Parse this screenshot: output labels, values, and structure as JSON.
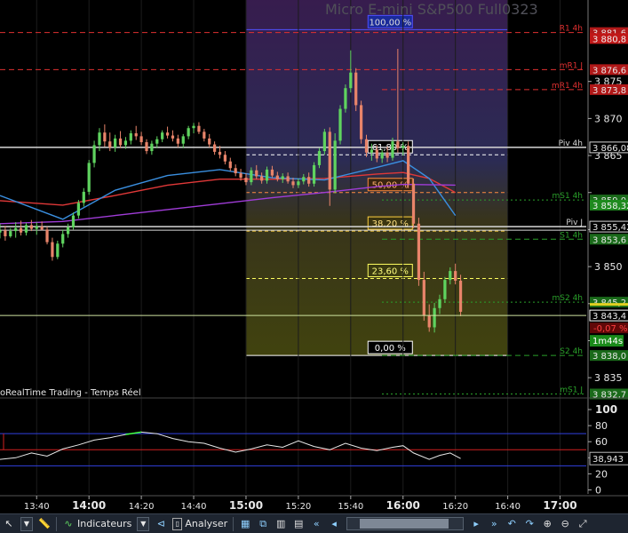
{
  "window_title": "Micro E-mini S&P500 Full0323",
  "subchart_title": "oRealTime Trading - Temps Réel",
  "colors": {
    "background": "#000000",
    "up": "#5fd35f",
    "down": "#e8846a",
    "resistance": "#e03030",
    "support": "#2aa02a",
    "pivot": "#d8d8d8"
  },
  "chart_data": {
    "type": "candlestick",
    "price_axis": {
      "range": [
        3832.5,
        3886.0
      ],
      "ticks": [
        3875,
        3870,
        3865,
        3860,
        3855,
        3850,
        3845,
        3840,
        3835
      ],
      "tick_labels": [
        "3 875",
        "3 870",
        "3 865",
        "",
        "",
        "3 850",
        "",
        "",
        "3 835"
      ]
    },
    "time_axis": {
      "start": "13:26",
      "end": "17:10",
      "ticks": [
        "13:40",
        "14:00",
        "14:20",
        "14:40",
        "15:00",
        "15:20",
        "15:40",
        "16:00",
        "16:20",
        "16:40",
        "17:00"
      ],
      "bold_ticks": [
        "14:00",
        "15:00",
        "16:00",
        "17:00"
      ]
    },
    "candles": [
      {
        "t": "13:26",
        "o": 3854.6,
        "h": 3855.8,
        "l": 3853.8,
        "c": 3854.9
      },
      {
        "t": "13:28",
        "o": 3854.9,
        "h": 3855.5,
        "l": 3853.5,
        "c": 3854.1
      },
      {
        "t": "13:30",
        "o": 3854.1,
        "h": 3855.2,
        "l": 3853.9,
        "c": 3854.8
      },
      {
        "t": "13:32",
        "o": 3854.8,
        "h": 3856.0,
        "l": 3853.9,
        "c": 3855.2
      },
      {
        "t": "13:34",
        "o": 3855.2,
        "h": 3856.2,
        "l": 3854.2,
        "c": 3854.6
      },
      {
        "t": "13:36",
        "o": 3854.6,
        "h": 3855.9,
        "l": 3854.2,
        "c": 3855.6
      },
      {
        "t": "13:38",
        "o": 3855.6,
        "h": 3856.3,
        "l": 3854.8,
        "c": 3855.1
      },
      {
        "t": "13:40",
        "o": 3855.1,
        "h": 3856.0,
        "l": 3854.3,
        "c": 3855.4
      },
      {
        "t": "13:42",
        "o": 3855.4,
        "h": 3856.1,
        "l": 3854.9,
        "c": 3855.0
      },
      {
        "t": "13:44",
        "o": 3855.0,
        "h": 3855.4,
        "l": 3853.0,
        "c": 3853.3
      },
      {
        "t": "13:46",
        "o": 3853.3,
        "h": 3853.9,
        "l": 3850.8,
        "c": 3851.3
      },
      {
        "t": "13:48",
        "o": 3851.3,
        "h": 3853.5,
        "l": 3851.0,
        "c": 3853.1
      },
      {
        "t": "13:50",
        "o": 3853.1,
        "h": 3855.0,
        "l": 3852.6,
        "c": 3854.4
      },
      {
        "t": "13:52",
        "o": 3854.4,
        "h": 3855.8,
        "l": 3853.9,
        "c": 3855.3
      },
      {
        "t": "13:54",
        "o": 3855.3,
        "h": 3857.3,
        "l": 3855.0,
        "c": 3856.9
      },
      {
        "t": "13:56",
        "o": 3856.9,
        "h": 3859.0,
        "l": 3856.5,
        "c": 3858.6
      },
      {
        "t": "13:58",
        "o": 3858.6,
        "h": 3860.6,
        "l": 3858.1,
        "c": 3860.1
      },
      {
        "t": "14:00",
        "o": 3860.1,
        "h": 3864.4,
        "l": 3859.7,
        "c": 3864.0
      },
      {
        "t": "14:02",
        "o": 3864.0,
        "h": 3867.0,
        "l": 3863.4,
        "c": 3866.4
      },
      {
        "t": "14:04",
        "o": 3866.4,
        "h": 3868.7,
        "l": 3865.6,
        "c": 3868.1
      },
      {
        "t": "14:06",
        "o": 3868.1,
        "h": 3869.2,
        "l": 3866.2,
        "c": 3866.9
      },
      {
        "t": "14:08",
        "o": 3866.9,
        "h": 3868.1,
        "l": 3865.6,
        "c": 3866.1
      },
      {
        "t": "14:10",
        "o": 3866.1,
        "h": 3867.8,
        "l": 3865.5,
        "c": 3867.3
      },
      {
        "t": "14:12",
        "o": 3867.3,
        "h": 3868.3,
        "l": 3866.0,
        "c": 3866.4
      },
      {
        "t": "14:14",
        "o": 3866.4,
        "h": 3867.5,
        "l": 3865.9,
        "c": 3867.0
      },
      {
        "t": "14:16",
        "o": 3867.0,
        "h": 3868.4,
        "l": 3866.5,
        "c": 3868.0
      },
      {
        "t": "14:18",
        "o": 3868.0,
        "h": 3869.0,
        "l": 3867.1,
        "c": 3867.6
      },
      {
        "t": "14:20",
        "o": 3867.6,
        "h": 3868.2,
        "l": 3866.4,
        "c": 3866.8
      },
      {
        "t": "14:22",
        "o": 3866.8,
        "h": 3867.2,
        "l": 3865.2,
        "c": 3865.6
      },
      {
        "t": "14:24",
        "o": 3865.6,
        "h": 3867.0,
        "l": 3865.1,
        "c": 3866.6
      },
      {
        "t": "14:26",
        "o": 3866.6,
        "h": 3867.6,
        "l": 3866.0,
        "c": 3867.2
      },
      {
        "t": "14:28",
        "o": 3867.2,
        "h": 3868.4,
        "l": 3866.8,
        "c": 3868.1
      },
      {
        "t": "14:30",
        "o": 3868.1,
        "h": 3868.9,
        "l": 3867.3,
        "c": 3867.7
      },
      {
        "t": "14:32",
        "o": 3867.7,
        "h": 3868.4,
        "l": 3866.9,
        "c": 3867.3
      },
      {
        "t": "14:34",
        "o": 3867.3,
        "h": 3867.8,
        "l": 3866.1,
        "c": 3866.6
      },
      {
        "t": "14:36",
        "o": 3866.6,
        "h": 3867.9,
        "l": 3866.0,
        "c": 3867.6
      },
      {
        "t": "14:38",
        "o": 3867.6,
        "h": 3869.0,
        "l": 3867.2,
        "c": 3868.7
      },
      {
        "t": "14:40",
        "o": 3868.7,
        "h": 3869.4,
        "l": 3868.0,
        "c": 3869.0
      },
      {
        "t": "14:42",
        "o": 3869.0,
        "h": 3869.5,
        "l": 3867.9,
        "c": 3868.2
      },
      {
        "t": "14:44",
        "o": 3868.2,
        "h": 3868.6,
        "l": 3866.9,
        "c": 3867.3
      },
      {
        "t": "14:46",
        "o": 3867.3,
        "h": 3867.9,
        "l": 3866.1,
        "c": 3866.5
      },
      {
        "t": "14:48",
        "o": 3866.5,
        "h": 3866.9,
        "l": 3865.1,
        "c": 3865.5
      },
      {
        "t": "14:50",
        "o": 3865.5,
        "h": 3866.3,
        "l": 3864.6,
        "c": 3865.1
      },
      {
        "t": "14:52",
        "o": 3865.1,
        "h": 3865.6,
        "l": 3863.8,
        "c": 3864.2
      },
      {
        "t": "14:54",
        "o": 3864.2,
        "h": 3864.7,
        "l": 3862.9,
        "c": 3863.3
      },
      {
        "t": "14:56",
        "o": 3863.3,
        "h": 3863.8,
        "l": 3862.2,
        "c": 3862.6
      },
      {
        "t": "14:58",
        "o": 3862.6,
        "h": 3863.2,
        "l": 3861.6,
        "c": 3862.0
      },
      {
        "t": "15:00",
        "o": 3862.0,
        "h": 3862.6,
        "l": 3861.0,
        "c": 3861.4
      },
      {
        "t": "15:02",
        "o": 3861.4,
        "h": 3863.4,
        "l": 3861.0,
        "c": 3863.0
      },
      {
        "t": "15:04",
        "o": 3863.0,
        "h": 3863.7,
        "l": 3861.8,
        "c": 3862.2
      },
      {
        "t": "15:06",
        "o": 3862.2,
        "h": 3862.7,
        "l": 3861.2,
        "c": 3861.6
      },
      {
        "t": "15:08",
        "o": 3861.6,
        "h": 3863.5,
        "l": 3861.2,
        "c": 3863.1
      },
      {
        "t": "15:10",
        "o": 3863.1,
        "h": 3863.6,
        "l": 3862.0,
        "c": 3862.3
      },
      {
        "t": "15:12",
        "o": 3862.3,
        "h": 3862.8,
        "l": 3861.5,
        "c": 3861.8
      },
      {
        "t": "15:14",
        "o": 3861.8,
        "h": 3862.6,
        "l": 3861.3,
        "c": 3862.2
      },
      {
        "t": "15:16",
        "o": 3862.2,
        "h": 3862.7,
        "l": 3861.2,
        "c": 3861.5
      },
      {
        "t": "15:18",
        "o": 3861.5,
        "h": 3862.0,
        "l": 3860.6,
        "c": 3861.0
      },
      {
        "t": "15:20",
        "o": 3861.0,
        "h": 3861.9,
        "l": 3860.6,
        "c": 3861.5
      },
      {
        "t": "15:22",
        "o": 3861.5,
        "h": 3862.5,
        "l": 3861.1,
        "c": 3862.1
      },
      {
        "t": "15:24",
        "o": 3862.1,
        "h": 3862.7,
        "l": 3860.8,
        "c": 3861.2
      },
      {
        "t": "15:26",
        "o": 3861.2,
        "h": 3864.1,
        "l": 3860.8,
        "c": 3863.7
      },
      {
        "t": "15:28",
        "o": 3863.7,
        "h": 3866.0,
        "l": 3863.3,
        "c": 3865.6
      },
      {
        "t": "15:30",
        "o": 3865.6,
        "h": 3868.6,
        "l": 3865.1,
        "c": 3868.2
      },
      {
        "t": "15:32",
        "o": 3868.2,
        "h": 3868.8,
        "l": 3858.2,
        "c": 3860.4
      },
      {
        "t": "15:34",
        "o": 3860.4,
        "h": 3868.0,
        "l": 3859.9,
        "c": 3867.0
      },
      {
        "t": "15:36",
        "o": 3867.0,
        "h": 3871.8,
        "l": 3866.5,
        "c": 3871.3
      },
      {
        "t": "15:38",
        "o": 3871.3,
        "h": 3874.6,
        "l": 3870.8,
        "c": 3874.1
      },
      {
        "t": "15:40",
        "o": 3874.1,
        "h": 3879.2,
        "l": 3873.5,
        "c": 3876.2
      },
      {
        "t": "15:42",
        "o": 3876.2,
        "h": 3876.8,
        "l": 3871.0,
        "c": 3871.8
      },
      {
        "t": "15:44",
        "o": 3871.8,
        "h": 3872.4,
        "l": 3866.6,
        "c": 3867.2
      },
      {
        "t": "15:46",
        "o": 3867.2,
        "h": 3867.8,
        "l": 3864.8,
        "c": 3865.4
      },
      {
        "t": "15:48",
        "o": 3865.4,
        "h": 3866.6,
        "l": 3864.3,
        "c": 3865.8
      },
      {
        "t": "15:50",
        "o": 3865.8,
        "h": 3866.4,
        "l": 3864.1,
        "c": 3864.6
      },
      {
        "t": "15:52",
        "o": 3864.6,
        "h": 3865.8,
        "l": 3864.0,
        "c": 3865.4
      },
      {
        "t": "15:54",
        "o": 3865.4,
        "h": 3866.2,
        "l": 3864.1,
        "c": 3864.7
      },
      {
        "t": "15:56",
        "o": 3864.7,
        "h": 3867.4,
        "l": 3864.3,
        "c": 3866.9
      },
      {
        "t": "15:58",
        "o": 3866.9,
        "h": 3879.4,
        "l": 3865.4,
        "c": 3866.0
      },
      {
        "t": "16:00",
        "o": 3866.0,
        "h": 3866.8,
        "l": 3865.0,
        "c": 3866.3
      },
      {
        "t": "16:02",
        "o": 3866.3,
        "h": 3866.9,
        "l": 3860.6,
        "c": 3861.2
      },
      {
        "t": "16:04",
        "o": 3861.2,
        "h": 3861.9,
        "l": 3855.2,
        "c": 3855.8
      },
      {
        "t": "16:06",
        "o": 3855.8,
        "h": 3856.6,
        "l": 3847.4,
        "c": 3848.2
      },
      {
        "t": "16:08",
        "o": 3848.2,
        "h": 3849.3,
        "l": 3842.7,
        "c": 3843.4
      },
      {
        "t": "16:10",
        "o": 3843.4,
        "h": 3844.9,
        "l": 3841.2,
        "c": 3841.8
      },
      {
        "t": "16:12",
        "o": 3841.8,
        "h": 3845.1,
        "l": 3841.1,
        "c": 3844.4
      },
      {
        "t": "16:14",
        "o": 3844.4,
        "h": 3846.2,
        "l": 3843.6,
        "c": 3845.6
      },
      {
        "t": "16:16",
        "o": 3845.6,
        "h": 3848.6,
        "l": 3845.1,
        "c": 3848.2
      },
      {
        "t": "16:18",
        "o": 3848.2,
        "h": 3849.9,
        "l": 3847.6,
        "c": 3849.4
      },
      {
        "t": "16:20",
        "o": 3849.4,
        "h": 3850.4,
        "l": 3847.6,
        "c": 3848.1
      },
      {
        "t": "16:22",
        "o": 3848.1,
        "h": 3848.9,
        "l": 3843.3,
        "c": 3843.9
      }
    ],
    "moving_averages": [
      {
        "color": "#e03838",
        "points": [
          [
            "13:26",
            3858.9
          ],
          [
            "13:50",
            3858.3
          ],
          [
            "14:10",
            3859.6
          ],
          [
            "14:30",
            3861.0
          ],
          [
            "14:50",
            3861.8
          ],
          [
            "15:10",
            3861.8
          ],
          [
            "15:30",
            3861.9
          ],
          [
            "15:50",
            3862.5
          ],
          [
            "16:00",
            3862.7
          ],
          [
            "16:10",
            3861.9
          ],
          [
            "16:20",
            3860.0
          ]
        ]
      },
      {
        "color": "#3a8fe0",
        "points": [
          [
            "13:26",
            3859.6
          ],
          [
            "13:50",
            3856.4
          ],
          [
            "14:10",
            3860.3
          ],
          [
            "14:30",
            3862.3
          ],
          [
            "14:50",
            3863.1
          ],
          [
            "15:10",
            3862.0
          ],
          [
            "15:30",
            3861.7
          ],
          [
            "15:50",
            3863.4
          ],
          [
            "16:00",
            3864.3
          ],
          [
            "16:10",
            3861.9
          ],
          [
            "16:20",
            3856.9
          ]
        ]
      },
      {
        "color": "#a03cd8",
        "points": [
          [
            "13:26",
            3855.8
          ],
          [
            "13:50",
            3856.1
          ],
          [
            "14:10",
            3856.9
          ],
          [
            "14:30",
            3857.7
          ],
          [
            "14:50",
            3858.5
          ],
          [
            "15:10",
            3859.3
          ],
          [
            "15:30",
            3860.0
          ],
          [
            "15:50",
            3860.8
          ],
          [
            "16:00",
            3861.1
          ],
          [
            "16:20",
            3861.0
          ]
        ]
      }
    ],
    "levels": [
      {
        "name": "R1 4h",
        "value": 3881.6,
        "label": "3 881,6",
        "color": "#e03030",
        "style": "dash"
      },
      {
        "name": "mR1 J",
        "value": 3876.6,
        "label": "3 876,6",
        "color": "#e03030",
        "style": "dash"
      },
      {
        "name": "mR1 4h",
        "value": 3873.9,
        "label": "3 873,8",
        "color": "#e03030",
        "style": "dash"
      },
      {
        "name": "Piv 4h",
        "value": 3866.1,
        "label": "3 866,08",
        "color": "#d8d8d8",
        "style": "solid"
      },
      {
        "name": "mS1 4h",
        "value": 3859.0,
        "label": "3 859,0",
        "color": "#2aa02a",
        "style": "dot"
      },
      {
        "name": "Piv J",
        "value": 3855.4,
        "label": "3 855,42",
        "color": "#d8d8d8",
        "style": "solid"
      },
      {
        "name": "S1 4h",
        "value": 3853.7,
        "label": "3 853,6",
        "color": "#2aa02a",
        "style": "dash"
      },
      {
        "name": "mS2 4h",
        "value": 3845.2,
        "label": "3 845,2",
        "color": "#2aa02a",
        "style": "dot"
      },
      {
        "name": "S2 4h",
        "value": 3838.0,
        "label": "3 838,0",
        "color": "#2aa02a",
        "style": "dash"
      },
      {
        "name": "mS1 J",
        "value": 3832.8,
        "label": "3 832,7",
        "color": "#2aa02a",
        "style": "dot"
      }
    ],
    "price_tags": [
      {
        "value": 3880.8,
        "label": "3 880,8",
        "color": "#c01818"
      },
      {
        "value": 3858.3,
        "label": "3 858,32",
        "color": "#1e8a1e"
      },
      {
        "value": 3843.4,
        "label": "3 843,4",
        "color": "#ffffff"
      }
    ],
    "current_price": 3843.4,
    "countdown": "1m44s",
    "change_label": "-0,07 %",
    "fibonacci": {
      "start_time": "15:00",
      "end_time": "16:40",
      "levels": [
        {
          "label": "100,00 %",
          "value": 3882.0
        },
        {
          "label": "61,80 %",
          "value": 3865.1
        },
        {
          "label": "50,00 %",
          "value": 3860.0
        },
        {
          "label": "38,20 %",
          "value": 3854.8
        },
        {
          "label": "23,60 %",
          "value": 3848.4
        },
        {
          "label": "0,00 %",
          "value": 3838.0
        }
      ]
    },
    "oscillator": {
      "range": [
        -5,
        110
      ],
      "ticks": [
        100,
        80,
        60,
        40,
        20,
        0
      ],
      "bands": [
        70,
        50,
        30
      ],
      "current_label": "38,943",
      "series": [
        [
          "13:26",
          38
        ],
        [
          "13:32",
          40
        ],
        [
          "13:38",
          46
        ],
        [
          "13:44",
          42
        ],
        [
          "13:50",
          51
        ],
        [
          "13:56",
          56
        ],
        [
          "14:02",
          62
        ],
        [
          "14:08",
          65
        ],
        [
          "14:14",
          69
        ],
        [
          "14:20",
          72
        ],
        [
          "14:26",
          70
        ],
        [
          "14:32",
          64
        ],
        [
          "14:38",
          60
        ],
        [
          "14:44",
          58
        ],
        [
          "14:50",
          52
        ],
        [
          "14:56",
          47
        ],
        [
          "15:02",
          51
        ],
        [
          "15:08",
          56
        ],
        [
          "15:14",
          53
        ],
        [
          "15:20",
          61
        ],
        [
          "15:26",
          54
        ],
        [
          "15:32",
          50
        ],
        [
          "15:38",
          58
        ],
        [
          "15:44",
          52
        ],
        [
          "15:50",
          49
        ],
        [
          "15:56",
          53
        ],
        [
          "16:00",
          55
        ],
        [
          "16:04",
          46
        ],
        [
          "16:10",
          38
        ],
        [
          "16:14",
          43
        ],
        [
          "16:18",
          46
        ],
        [
          "16:22",
          39
        ]
      ]
    }
  },
  "toolbar": {
    "indicators_label": "Indicateurs",
    "analyze_label": "Analyser"
  }
}
